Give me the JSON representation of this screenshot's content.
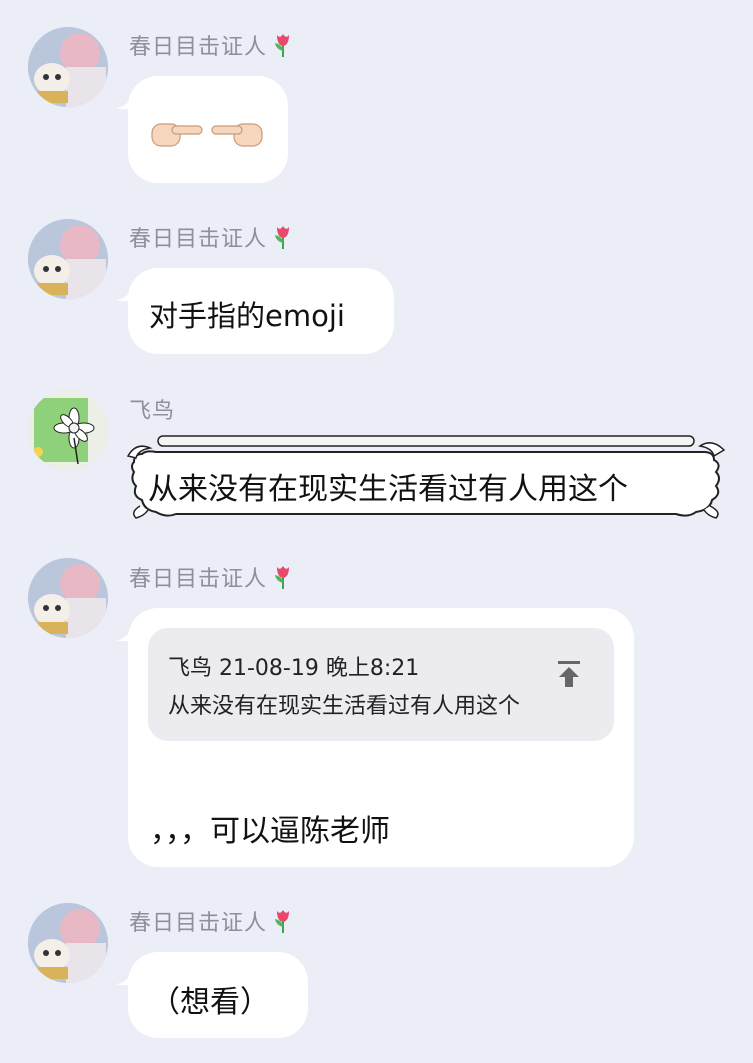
{
  "colors": {
    "background": "#eceef7",
    "bubble": "#ffffff",
    "quote_bg": "#ececf0",
    "name": "#8e8f98"
  },
  "messages": [
    {
      "sender": "春日目击证人",
      "kind": "emoji",
      "text": "",
      "icon": "pointing-fingers-emoji"
    },
    {
      "sender": "春日目击证人",
      "kind": "text",
      "text": "对手指的emoji"
    },
    {
      "sender": "飞鸟",
      "kind": "decorated-text",
      "text": "从来没有在现实生活看过有人用这个"
    },
    {
      "sender": "春日目击证人",
      "kind": "reply",
      "quote": {
        "header": "飞鸟 21-08-19 晚上8:21",
        "text": "从来没有在现实生活看过有人用这个",
        "icon": "jump-to-top-icon"
      },
      "text": "，，，可以逼陈老师"
    },
    {
      "sender": "春日目击证人",
      "kind": "text",
      "text": "（想看）"
    }
  ]
}
